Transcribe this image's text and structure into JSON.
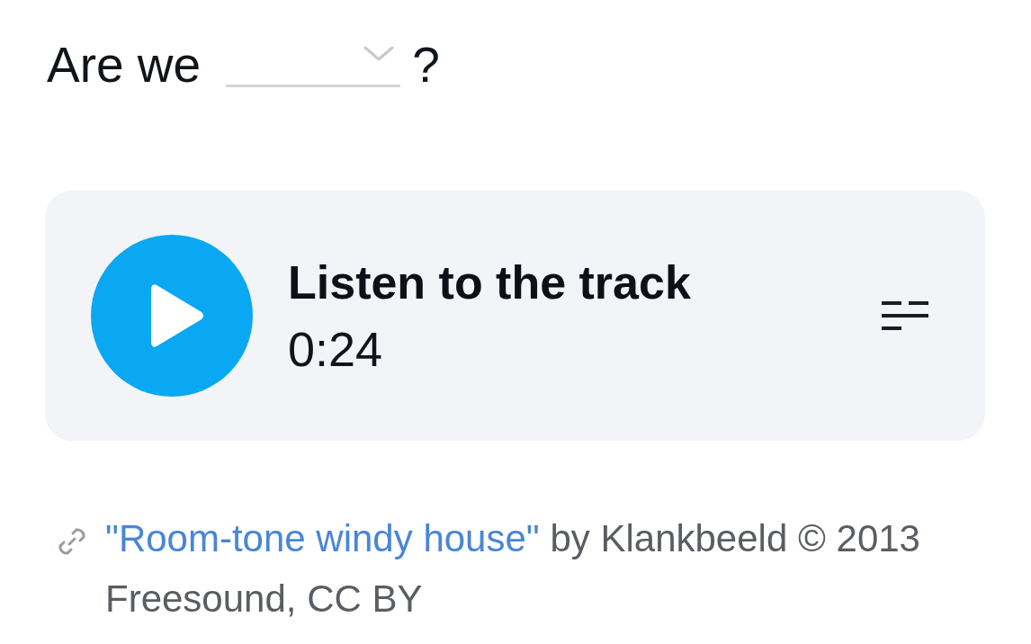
{
  "question": {
    "text_before": "Are we",
    "dropdown": {
      "expanded": false
    },
    "text_after": "?"
  },
  "player": {
    "playing": false,
    "title": "Listen to the track",
    "duration": "0:24"
  },
  "attribution": {
    "link_text": "\"Room-tone windy house\"",
    "text": "by Klankbeeld © 2013 Freesound, CC BY"
  }
}
